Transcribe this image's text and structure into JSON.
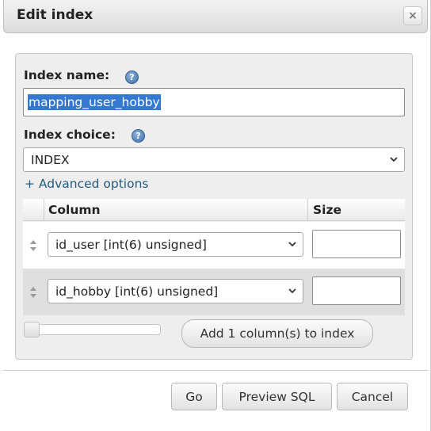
{
  "dialog": {
    "title": "Edit index",
    "close_symbol": "×"
  },
  "form": {
    "index_name_label": "Index name:",
    "index_name_value": "mapping_user_hobby",
    "index_choice_label": "Index choice:",
    "index_choice_value": "INDEX",
    "advanced_link": "+ Advanced options",
    "help_symbol": "?"
  },
  "table": {
    "headers": {
      "column": "Column",
      "size": "Size"
    },
    "rows": [
      {
        "column": "id_user [int(6) unsigned]",
        "size": ""
      },
      {
        "column": "id_hobby [int(6) unsigned]",
        "size": ""
      }
    ]
  },
  "add_columns_button": "Add 1 column(s) to index",
  "footer": {
    "go": "Go",
    "preview_sql": "Preview SQL",
    "cancel": "Cancel"
  },
  "icons": {
    "help": "help-icon",
    "close": "close-icon",
    "chevron": "chevron-down-icon",
    "drag": "drag-handle-icon"
  },
  "colors": {
    "selection": "#3478d4",
    "link": "#235a81",
    "fieldset_bg": "#eeeeee"
  }
}
